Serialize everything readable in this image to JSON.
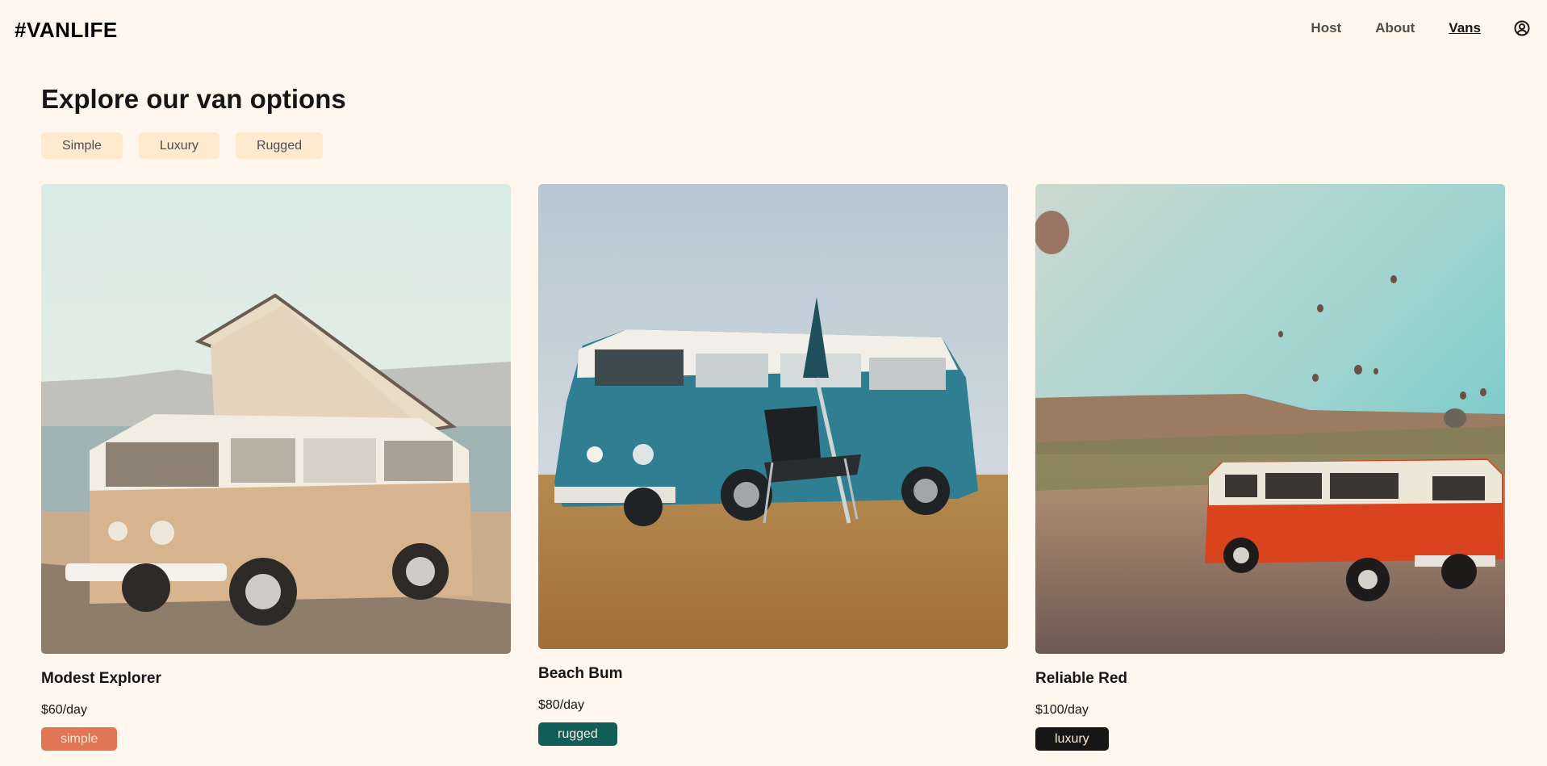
{
  "header": {
    "logo": "#VANLIFE",
    "nav": [
      {
        "label": "Host",
        "active": false
      },
      {
        "label": "About",
        "active": false
      },
      {
        "label": "Vans",
        "active": true
      }
    ],
    "user_icon": "user-circle-icon"
  },
  "main": {
    "title": "Explore our van options",
    "filters": [
      "Simple",
      "Luxury",
      "Rugged"
    ]
  },
  "vans": [
    {
      "name": "Modest Explorer",
      "price": "$60/day",
      "type": "simple",
      "badge_color": "#E17654",
      "photo": "beige-vw-camper-by-sea"
    },
    {
      "name": "Beach Bum",
      "price": "$80/day",
      "type": "rugged",
      "badge_color": "#115E59",
      "photo": "teal-vw-bus-with-chair"
    },
    {
      "name": "Reliable Red",
      "price": "$100/day",
      "type": "luxury",
      "badge_color": "#161616",
      "photo": "red-vw-bus-with-balloons"
    }
  ],
  "colors": {
    "background": "#FFF7ED",
    "filter_bg": "#FFEAD0",
    "text": "#161616",
    "nav_text": "#4D4D4D"
  }
}
